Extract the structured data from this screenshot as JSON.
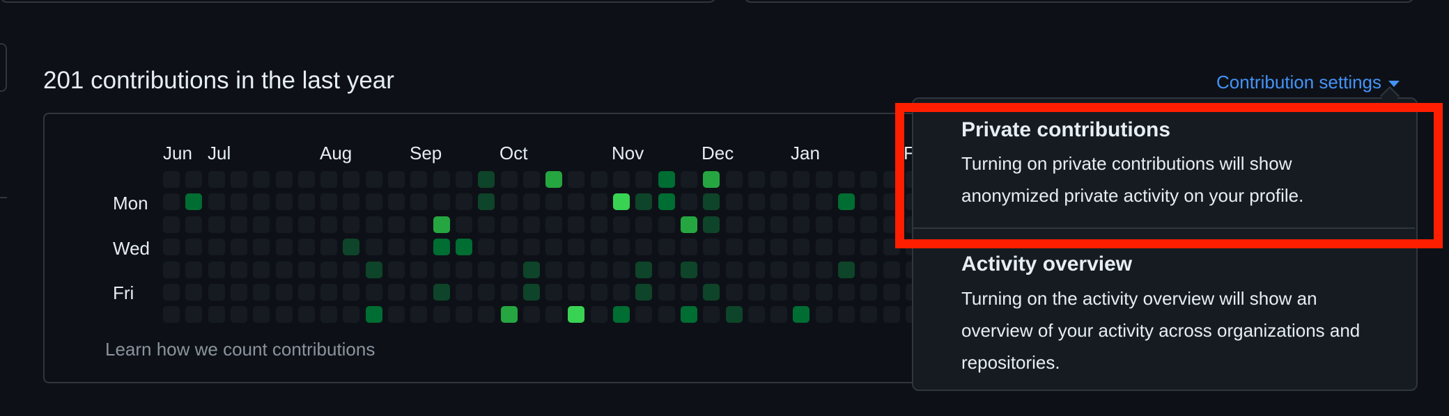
{
  "heading": "201 contributions in the last year",
  "settings": {
    "label": "Contribution settings",
    "caret_icon": "caret-down-icon"
  },
  "months": [
    "Jun",
    "Jul",
    "Aug",
    "Sep",
    "Oct",
    "Nov",
    "Dec",
    "Jan"
  ],
  "hidden_month_fragment": "F",
  "days": [
    "Mon",
    "Wed",
    "Fri"
  ],
  "learn_link": "Learn how we count contributions",
  "menu": {
    "items": [
      {
        "title": "Private contributions",
        "desc": [
          "Turning on private contributions will show",
          "anonymized private activity on your profile."
        ]
      },
      {
        "title": "Activity overview",
        "desc": [
          "Turning on the activity overview will show an",
          "overview of your activity across organizations and",
          "repositories."
        ]
      }
    ]
  },
  "contribution_levels": {
    "description": "visible contribution cells by week (0-33) and day row (0=Sun..6=Sat); level 1-4",
    "cells": [
      {
        "w": 14,
        "d": 0,
        "l": 1
      },
      {
        "w": 17,
        "d": 0,
        "l": 3
      },
      {
        "w": 22,
        "d": 0,
        "l": 2
      },
      {
        "w": 24,
        "d": 0,
        "l": 3
      },
      {
        "w": 1,
        "d": 1,
        "l": 2
      },
      {
        "w": 14,
        "d": 1,
        "l": 1
      },
      {
        "w": 20,
        "d": 1,
        "l": 4
      },
      {
        "w": 21,
        "d": 1,
        "l": 1
      },
      {
        "w": 22,
        "d": 1,
        "l": 2
      },
      {
        "w": 24,
        "d": 1,
        "l": 1
      },
      {
        "w": 30,
        "d": 1,
        "l": 2
      },
      {
        "w": 12,
        "d": 2,
        "l": 3
      },
      {
        "w": 23,
        "d": 2,
        "l": 3
      },
      {
        "w": 24,
        "d": 2,
        "l": 1
      },
      {
        "w": 8,
        "d": 3,
        "l": 1
      },
      {
        "w": 12,
        "d": 3,
        "l": 2
      },
      {
        "w": 13,
        "d": 3,
        "l": 2
      },
      {
        "w": 9,
        "d": 4,
        "l": 1
      },
      {
        "w": 16,
        "d": 4,
        "l": 1
      },
      {
        "w": 21,
        "d": 4,
        "l": 1
      },
      {
        "w": 23,
        "d": 4,
        "l": 1
      },
      {
        "w": 30,
        "d": 4,
        "l": 1
      },
      {
        "w": 12,
        "d": 5,
        "l": 1
      },
      {
        "w": 16,
        "d": 5,
        "l": 1
      },
      {
        "w": 21,
        "d": 5,
        "l": 1
      },
      {
        "w": 24,
        "d": 5,
        "l": 1
      },
      {
        "w": 9,
        "d": 6,
        "l": 2
      },
      {
        "w": 15,
        "d": 6,
        "l": 3
      },
      {
        "w": 18,
        "d": 6,
        "l": 4
      },
      {
        "w": 20,
        "d": 6,
        "l": 2
      },
      {
        "w": 23,
        "d": 6,
        "l": 2
      },
      {
        "w": 25,
        "d": 6,
        "l": 1
      },
      {
        "w": 28,
        "d": 6,
        "l": 2
      }
    ]
  },
  "colors": {
    "empty": "#161b22",
    "level1": "#0e4429",
    "level2": "#006d32",
    "level3": "#26a641",
    "level4": "#39d353",
    "link": "#4493f8",
    "highlight": "#ff1e00"
  }
}
